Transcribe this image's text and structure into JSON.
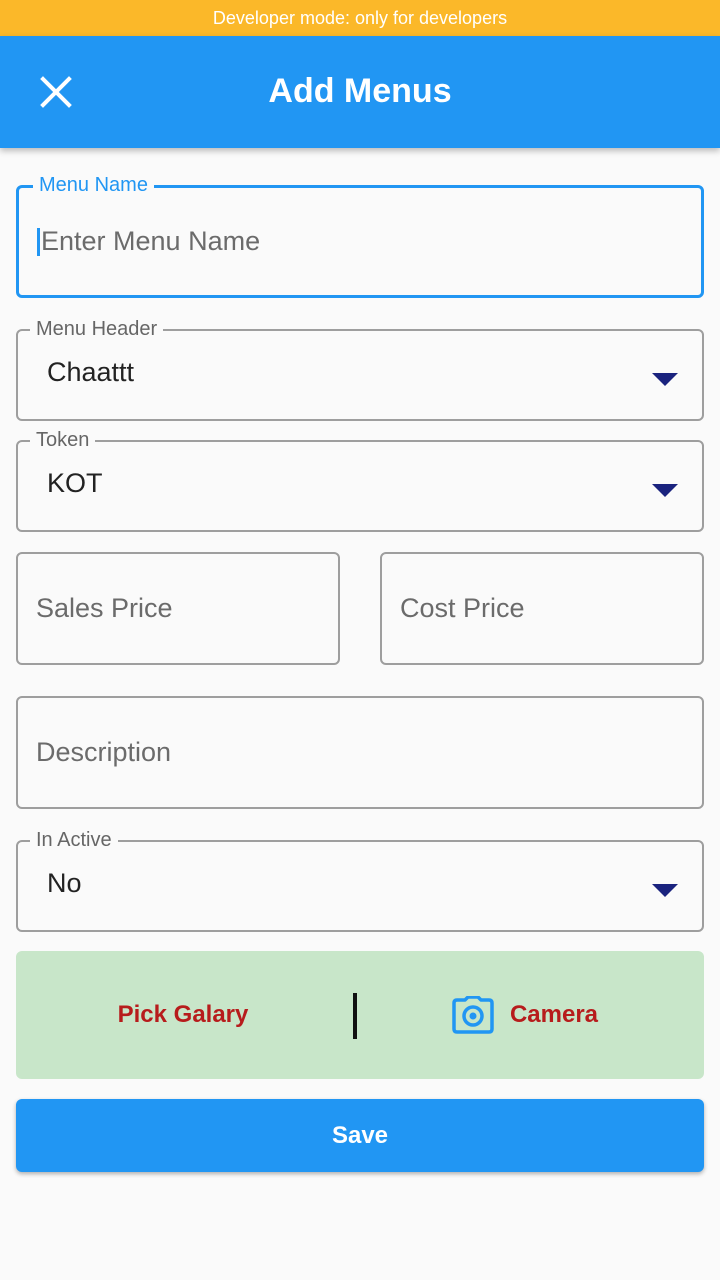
{
  "dev_banner": "Developer mode: only for developers",
  "appbar": {
    "title": "Add Menus",
    "close_icon": "close-icon"
  },
  "form": {
    "menu_name": {
      "label": "Menu Name",
      "placeholder": "Enter Menu Name",
      "value": ""
    },
    "menu_header": {
      "label": "Menu Header",
      "value": "Chaattt"
    },
    "token": {
      "label": "Token",
      "value": "KOT"
    },
    "sales_price": {
      "placeholder": "Sales Price",
      "value": ""
    },
    "cost_price": {
      "placeholder": "Cost Price",
      "value": ""
    },
    "description": {
      "placeholder": "Description",
      "value": ""
    },
    "in_active": {
      "label": "In Active",
      "value": "No"
    }
  },
  "image_picker": {
    "gallery_label": "Pick Galary",
    "camera_label": "Camera",
    "camera_icon": "camera-icon"
  },
  "save_label": "Save",
  "colors": {
    "primary": "#2196f3",
    "dev_banner": "#fbb829",
    "picker_bg": "#c8e6c9",
    "picker_text": "#b71c1c",
    "dropdown_arrow": "#1a237e"
  }
}
